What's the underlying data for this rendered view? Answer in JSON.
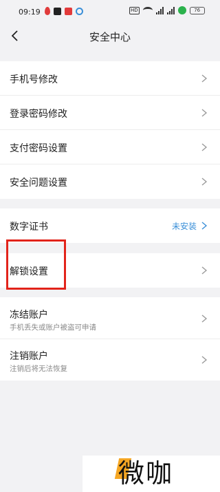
{
  "status_bar": {
    "time": "09:19",
    "hd_label": "HD",
    "battery": "76"
  },
  "header": {
    "title": "安全中心"
  },
  "groups": [
    {
      "items": [
        {
          "label": "手机号修改"
        },
        {
          "label": "登录密码修改"
        },
        {
          "label": "支付密码设置"
        },
        {
          "label": "安全问题设置"
        }
      ]
    },
    {
      "items": [
        {
          "label": "数字证书",
          "status": "未安装",
          "status_color": "#3a8fd8"
        }
      ]
    },
    {
      "items": [
        {
          "label": "解锁设置"
        }
      ]
    },
    {
      "items": [
        {
          "label": "冻结账户",
          "sub": "手机丢失或账户被盗可申请"
        },
        {
          "label": "注销账户",
          "sub": "注销后将无法恢复"
        }
      ]
    }
  ],
  "annotation": {
    "highlight_color": "#e2231a"
  },
  "watermark": {
    "text": "微咖",
    "accent_color": "#f5a623"
  }
}
